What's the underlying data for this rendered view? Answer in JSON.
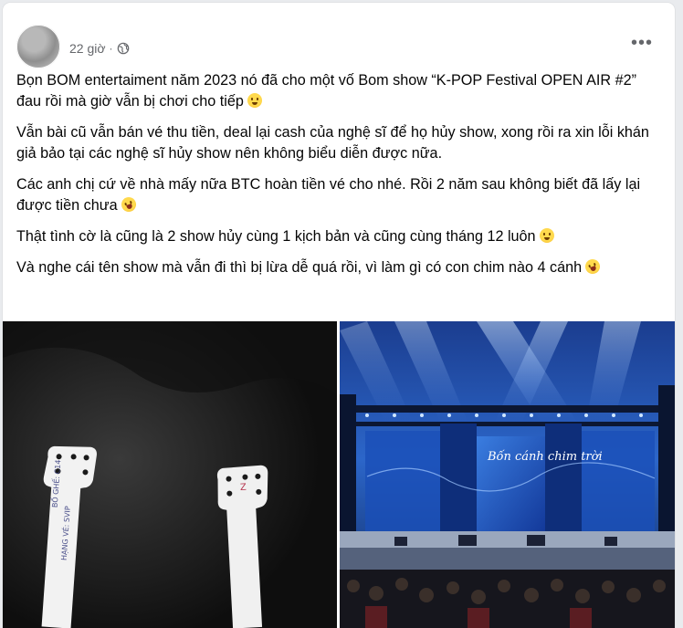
{
  "post": {
    "time": "22 giờ",
    "separator": "·",
    "more": "•••",
    "paragraphs": [
      "Bọn BOM entertaiment năm 2023 nó đã cho một vố Bom show “K-POP Festival OPEN AIR #2” đau rồi mà giờ vẫn bị chơi cho tiếp",
      "Vẫn bài cũ vẫn bán vé thu tiền, deal lại cash của nghệ sĩ để họ hủy show, xong rồi ra xin lỗi khán giả bảo tại các nghệ sĩ hủy show nên không biểu diễn được nữa.",
      "Các anh chị cứ về nhà mấy nữa BTC hoàn tiền vé cho nhé. Rồi 2 năm sau không biết đã lấy lại được tiền chưa",
      "Thật tình cờ là cũng là 2 show hủy cùng 1 kịch bản và cũng cùng tháng 12 luôn",
      "Và nghe cái tên show mà vẫn đi thì bị lừa dễ quá rồi, vì làm gì có con chim nào 4 cánh"
    ],
    "emojis": [
      "worried-face",
      "rolling-laughing-face",
      "flushed-face",
      "rolling-laughing-face"
    ]
  },
  "photos": {
    "left": {
      "text_left": "BỐ GHẾ: C14",
      "text_left_2": "HẠNG VÉ: SVIP",
      "text_right": "Z"
    },
    "right": {
      "banner_title": "Bốn cánh chim trời"
    }
  }
}
